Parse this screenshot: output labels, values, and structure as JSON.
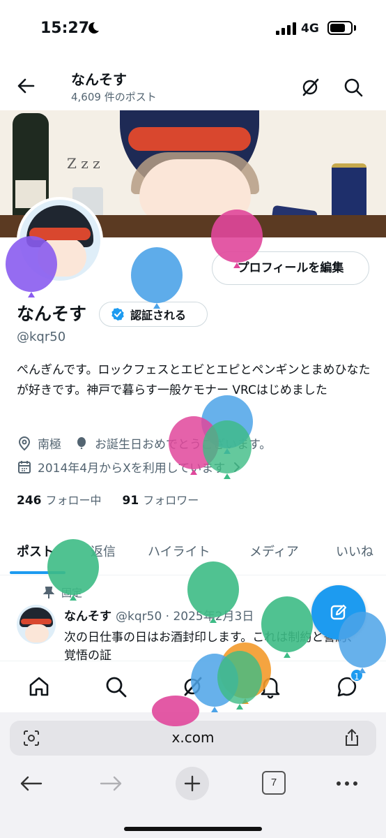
{
  "status_bar": {
    "time": "15:27",
    "network": "4G"
  },
  "header": {
    "name": "なんそす",
    "post_count": "4,609 件のポスト"
  },
  "profile": {
    "edit_button": "プロフィールを編集",
    "display_name": "なんそす",
    "verify_button": "認証される",
    "handle": "@kqr50",
    "bio": "ぺんぎんです。ロックフェスとエビとエピとペンギンとまめひなたが好きです。神戸で暮らす一般ケモナー VRCはじめました",
    "location": "南極",
    "birthday": "お誕生日おめでとうございます。",
    "joined": "2014年4月からXを利用しています",
    "following_count": "246",
    "following_label": "フォロー中",
    "followers_count": "91",
    "followers_label": "フォロワー"
  },
  "tabs": [
    {
      "label": "ポスト"
    },
    {
      "label": "返信"
    },
    {
      "label": "ハイライト"
    },
    {
      "label": "メディア"
    },
    {
      "label": "いいね"
    }
  ],
  "pinned_post": {
    "pinned_label": "固定",
    "author": "なんそす",
    "meta": "@kqr50 · 2025年2月3日",
    "text": "次の日仕事の日はお酒封印します。これは制約と誓約、覚悟の証"
  },
  "bottom_nav": {
    "notification_badge": "1"
  },
  "browser": {
    "url": "x.com",
    "tab_count": "7"
  },
  "colors": {
    "accent": "#1d9bf0",
    "text_primary": "#0f1419",
    "text_secondary": "#536471",
    "balloons": [
      "#4ca3e8",
      "#e0479b",
      "#3dbb85",
      "#8a5cf0",
      "#f39a2b"
    ]
  },
  "icons": {
    "back": "arrow-left-icon",
    "grok": "grok-icon",
    "search": "search-icon",
    "location": "location-pin-icon",
    "birthday": "balloon-icon",
    "calendar": "calendar-icon",
    "pin": "pin-icon",
    "compose": "compose-icon"
  }
}
